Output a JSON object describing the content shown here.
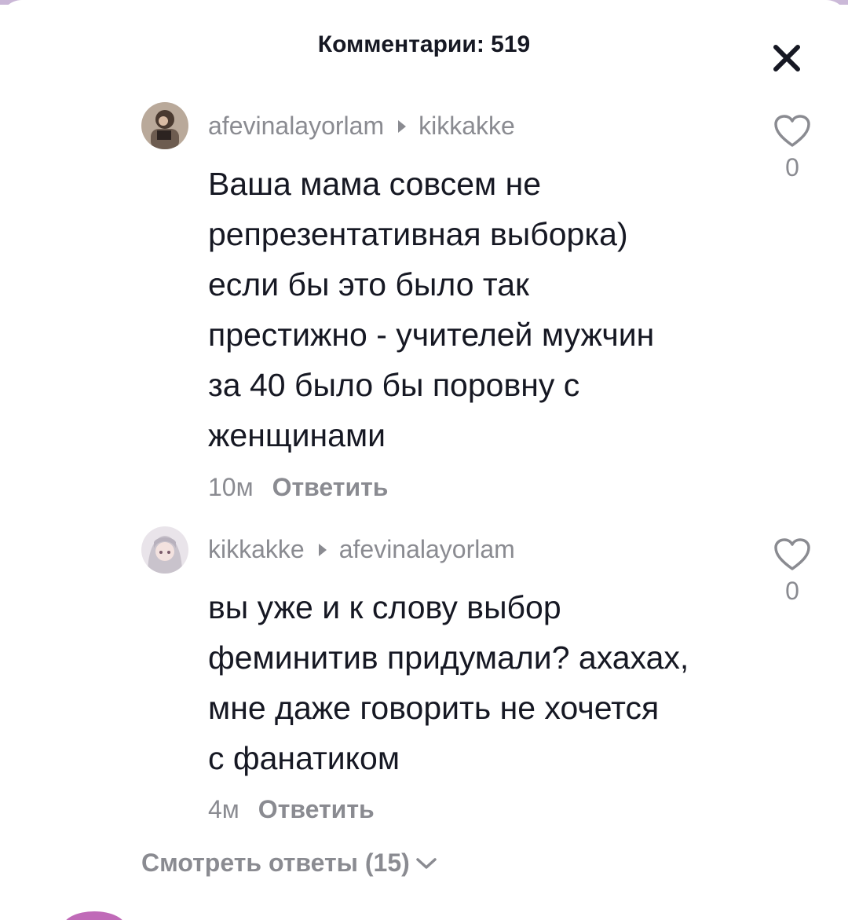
{
  "header": {
    "title": "Комментарии: 519"
  },
  "icons": {
    "close": "close-icon",
    "like": "heart-outline-icon",
    "reply_arrow": "caret-right-icon",
    "expand": "chevron-down-icon"
  },
  "colors": {
    "text_primary": "#161823",
    "text_secondary": "#8a8b91",
    "background": "#ffffff"
  },
  "comments": [
    {
      "author": "afevinalayorlam",
      "reply_to": "kikkakke",
      "lines": [
        "Ваша мама совсем не",
        "репрезентативная выборка)",
        "если бы это было так",
        "престижно - учителей мужчин",
        "за 40 было бы поровну с",
        "женщинами"
      ],
      "time": "10м",
      "reply_label": "Ответить",
      "likes": "0"
    },
    {
      "author": "kikkakke",
      "reply_to": "afevinalayorlam",
      "lines": [
        "вы уже и к слову выбор",
        "феминитив придумали? ахахах,",
        "мне даже говорить не хочется",
        "с фанатиком"
      ],
      "time": "4м",
      "reply_label": "Ответить",
      "likes": "0"
    }
  ],
  "view_replies": {
    "label": "Смотреть ответы (15)"
  }
}
